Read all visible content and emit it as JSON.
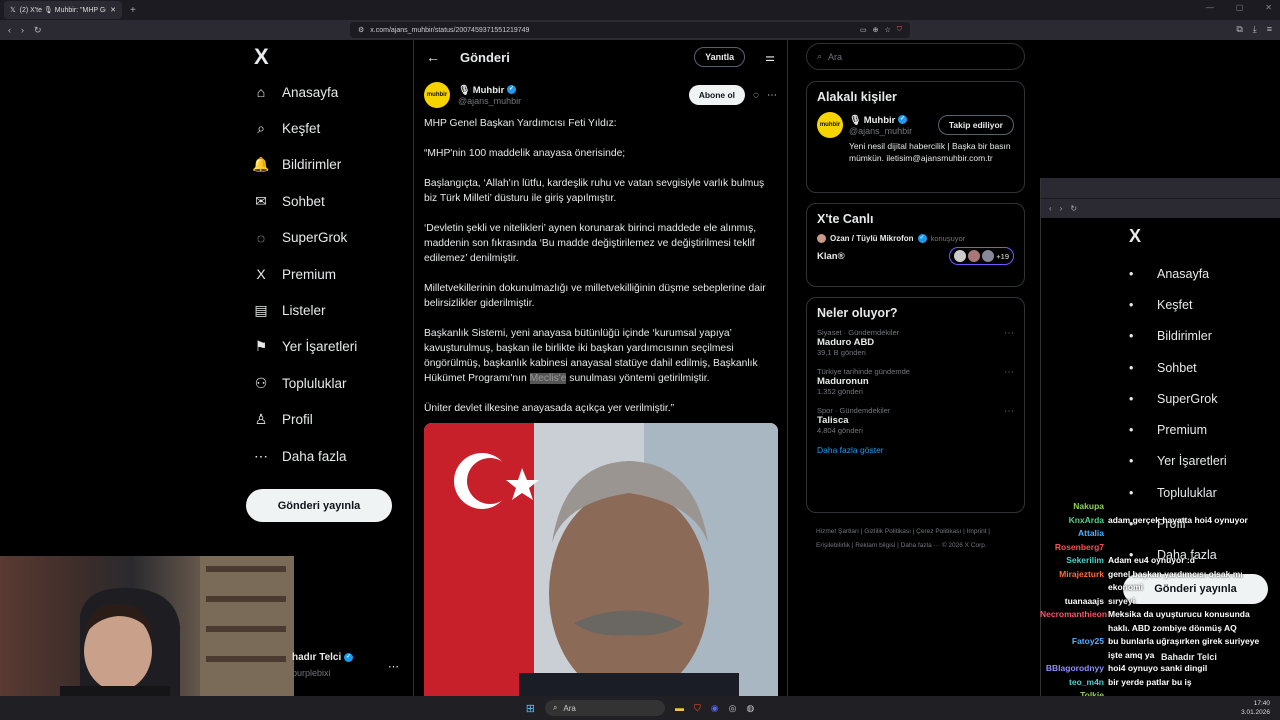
{
  "browser": {
    "tab_title": "(2) X'te 🎙 Muhbir: \"MHP Genel",
    "url": "x.com/ajans_muhbir/status/2007459371551219749",
    "new_tab": "+"
  },
  "nav": {
    "logo": "X",
    "items": [
      {
        "label": "Anasayfa",
        "icon": "⌂"
      },
      {
        "label": "Keşfet",
        "icon": "⌕"
      },
      {
        "label": "Bildirimler",
        "icon": "🔔"
      },
      {
        "label": "Sohbet",
        "icon": "✉"
      },
      {
        "label": "SuperGrok",
        "icon": "◌"
      },
      {
        "label": "Premium",
        "icon": "X"
      },
      {
        "label": "Listeler",
        "icon": "▤"
      },
      {
        "label": "Yer İşaretleri",
        "icon": "⚑"
      },
      {
        "label": "Topluluklar",
        "icon": "⚇"
      },
      {
        "label": "Profil",
        "icon": "♙"
      },
      {
        "label": "Daha fazla",
        "icon": "⋯"
      }
    ],
    "post_button": "Gönderi yayınla",
    "user_name": "hadır Telci",
    "user_handle": "purplebixi"
  },
  "post": {
    "header_title": "Gönderi",
    "reply_button": "Yanıtla",
    "author_name": "🎙 Muhbir",
    "author_handle": "@ajans_muhbir",
    "avatar_text": "muhbir",
    "subscribe_button": "Abone ol",
    "paragraphs": [
      "MHP Genel Başkan Yardımcısı Feti Yıldız:",
      "“MHP'nin 100 maddelik anayasa önerisinde;",
      "Başlangıçta, ‘Allah'ın lütfu, kardeşlik ruhu ve vatan sevgisiyle varlık bulmuş biz Türk Milleti’ düsturu ile giriş yapılmıştır.",
      "‘Devletin şekli ve nitelikleri’ aynen korunarak birinci maddede ele alınmış, maddenin son fıkrasında ‘Bu madde değiştirilemez ve değiştirilmesi teklif edilemez’ denilmiştir.",
      "Milletvekillerinin dokunulmazlığı ve milletvekilliğinin düşme sebeplerine dair belirsizlikler giderilmiştir."
    ],
    "p6_before": "Başkanlık Sistemi, yeni anayasa bütünlüğü içinde ‘kurumsal yapıya’ kavuşturulmuş, başkan ile birlikte iki başkan yardımcısının seçilmesi öngörülmüş, başkanlık kabinesi anayasal statüye dahil edilmiş, Başkanlık Hükümet Programı'nın ",
    "p6_highlight": "Meclis'e",
    "p6_after": " sunulması yöntemi getirilmiştir.",
    "p7": "Üniter devlet ilkesine anayasada açıkça yer verilmiştir.”"
  },
  "right": {
    "search_placeholder": "Ara",
    "related_title": "Alakalı kişiler",
    "related_name": "🎙 Muhbir",
    "related_handle": "@ajans_muhbir",
    "following_button": "Takip ediliyor",
    "related_bio": "Yeni nesil dijital habercilik | Başka bir basın mümkün. iletisim@ajansmuhbir.com.tr",
    "live_title": "X'te Canlı",
    "live_host": "Ozan / Tüylü Mikrofon",
    "live_status": "konuşuyor",
    "live_room": "Klan®",
    "live_count": "+19",
    "trends_title": "Neler oluyor?",
    "trends": [
      {
        "context": "Siyaset · Gündemdekiler",
        "name": "Maduro ABD",
        "count": "39,1 B gönderi"
      },
      {
        "context": "Türkiye tarihinde gündemde",
        "name": "Maduronun",
        "count": "1.352 gönderi"
      },
      {
        "context": "Spor · Gündemdekiler",
        "name": "Talisca",
        "count": "4.804 gönderi"
      }
    ],
    "show_more": "Daha fazla göster",
    "footer": "Hizmet Şartları | Gizlilik Politikası | Çerez Politikası | Imprint | Erişilebilirlik | Reklam bilgisi | Daha fazla ··· © 2026 X Corp."
  },
  "window2": {
    "logo": "X",
    "items": [
      "Anasayfa",
      "Keşfet",
      "Bildirimler",
      "Sohbet",
      "SuperGrok",
      "Premium",
      "Yer İşaretleri",
      "Topluluklar",
      "Profil",
      "Daha fazla"
    ],
    "post_button": "Gönderi yayınla",
    "user_name": "Bahadır Telci"
  },
  "chat": [
    {
      "name": "Nakupa",
      "msg": "",
      "color": "#8fd14f"
    },
    {
      "name": "KnxArda",
      "msg": "adam gerçek hayatta hoi4 oynuyor",
      "color": "#4fd18f"
    },
    {
      "name": "Attalia",
      "msg": "",
      "color": "#4fb0ff"
    },
    {
      "name": "Rosenberg7",
      "msg": "",
      "color": "#ff4f4f"
    },
    {
      "name": "Sekerilim",
      "msg": "Adam eu4 oynuyor :d",
      "color": "#4fd1d1"
    },
    {
      "name": "Mirajezturk",
      "msg": "genel başkan yardımcısı olsak mı",
      "color": "#ff6a3d"
    },
    {
      "name": "",
      "msg": "ekonomi",
      "color": "#ffffff"
    },
    {
      "name": "tuanaaajs",
      "msg": "sıryeyi",
      "color": "#ffffff"
    },
    {
      "name": "Necromanthieon",
      "msg": "Meksika da uyuşturucu konusunda",
      "color": "#ff4f6a"
    },
    {
      "name": "",
      "msg": "haklı. ABD zombiye dönmüş AQ",
      "color": "#ffffff"
    },
    {
      "name": "Fatoy25",
      "msg": "bu bunlarla uğraşırken girek suriyeye",
      "color": "#4fb0ff"
    },
    {
      "name": "",
      "msg": "işte amq ya",
      "color": "#ffffff"
    },
    {
      "name": "BBlagorodnyy",
      "msg": "hoi4 oynuyo sanki dingil",
      "color": "#8f8fff"
    },
    {
      "name": "teo_m4n",
      "msg": "bir yerde patlar bu iş",
      "color": "#4fd1d1"
    },
    {
      "name": "Tolkie",
      "msg": "",
      "color": "#8fd14f"
    }
  ],
  "taskbar": {
    "search": "Ara",
    "time": "17:40",
    "date": "3.01.2026"
  }
}
